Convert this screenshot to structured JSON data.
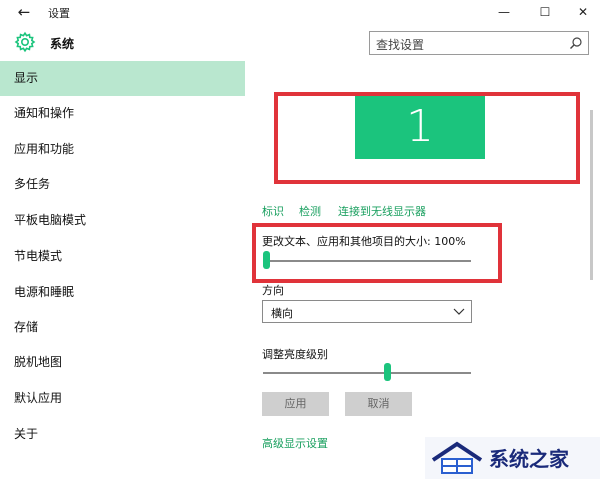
{
  "window": {
    "title": "设置",
    "back_glyph": "←",
    "minimize_glyph": "—",
    "maximize_glyph": "☐",
    "close_glyph": "✕"
  },
  "header": {
    "title": "系统",
    "icon": "gear-icon",
    "search_placeholder": "查找设置",
    "search_icon": "search-icon"
  },
  "sidebar": {
    "items": [
      {
        "label": "显示",
        "active": true
      },
      {
        "label": "通知和操作"
      },
      {
        "label": "应用和功能"
      },
      {
        "label": "多任务"
      },
      {
        "label": "平板电脑模式"
      },
      {
        "label": "节电模式"
      },
      {
        "label": "电源和睡眠"
      },
      {
        "label": "存储"
      },
      {
        "label": "脱机地图"
      },
      {
        "label": "默认应用"
      },
      {
        "label": "关于"
      }
    ]
  },
  "display": {
    "monitor_number": "1",
    "links": [
      "标识",
      "检测",
      "连接到无线显示器"
    ],
    "scale_label": "更改文本、应用和其他项目的大小: 100%",
    "scale_level": 0,
    "orientation_label": "方向",
    "orientation_value": "横向",
    "brightness_label": "调整亮度级别",
    "brightness_level": 0.6,
    "apply_button": "应用",
    "cancel_button": "取消",
    "advanced_link": "高级显示设置"
  },
  "colors": {
    "accent": "#1bc47d",
    "sidebar_active": "#b9e7cf",
    "highlight_box": "#e0333a",
    "link": "#189f5e"
  },
  "watermark": {
    "text": "系统之家"
  }
}
